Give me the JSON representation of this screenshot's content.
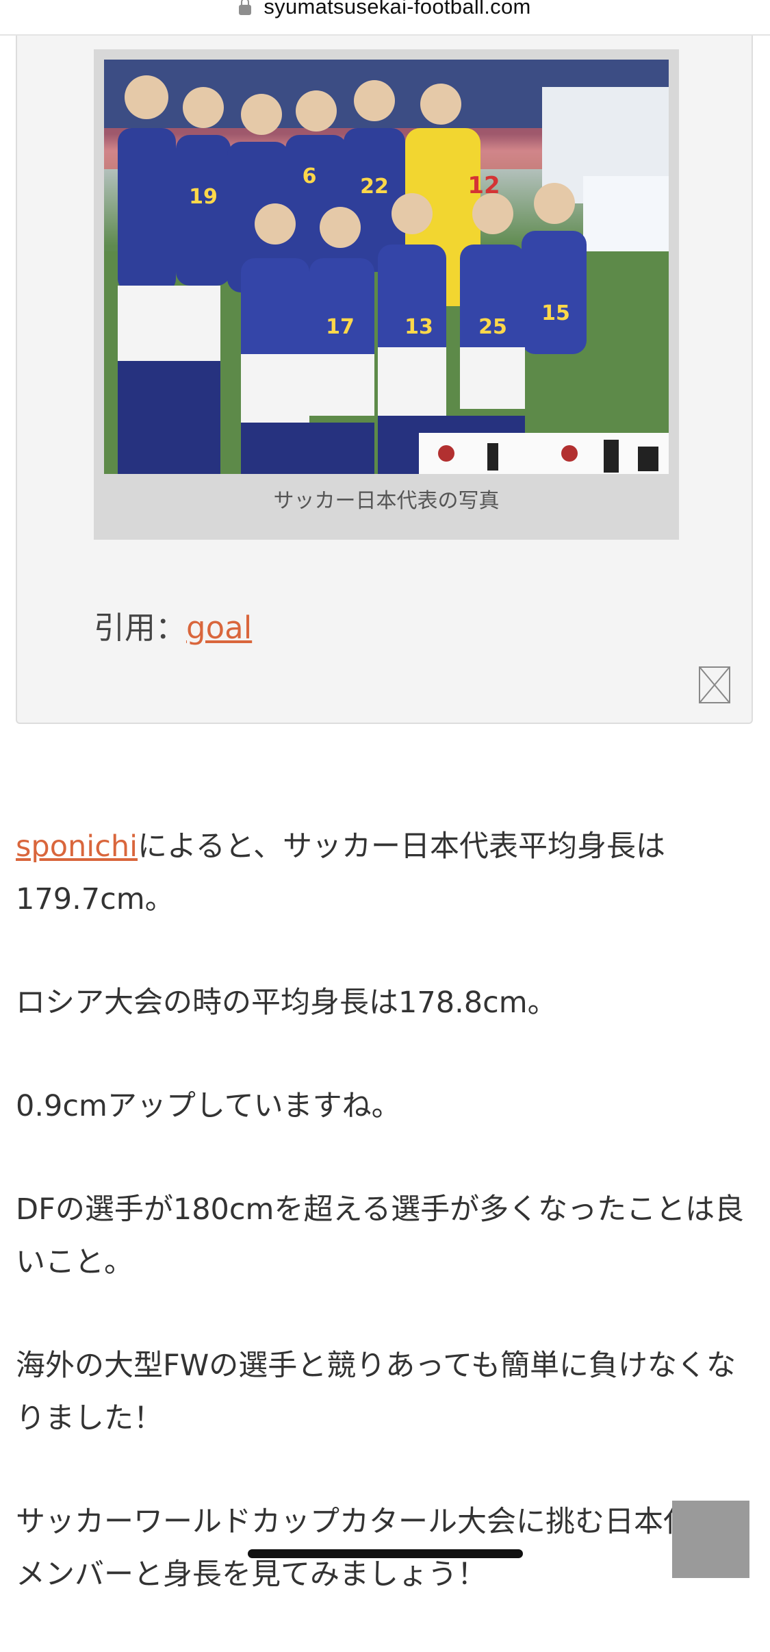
{
  "browser": {
    "url": "syumatsusekai-football.com"
  },
  "quote": {
    "caption": "サッカー日本代表の写真",
    "cite_prefix": "引用：",
    "cite_link": "goal",
    "jersey_numbers": [
      "19",
      "22",
      "12",
      "6",
      "13",
      "25",
      "15",
      "17"
    ]
  },
  "article": {
    "p1_link": "sponichi",
    "p1_text": "によると、サッカー日本代表平均身長は179.7cm。",
    "p2": "ロシア大会の時の平均身長は178.8cm。",
    "p3": "0.9cmアップしていますね。",
    "p4": "DFの選手が180cmを超える選手が多くなったことは良いこと。",
    "p5": "海外の大型FWの選手と競りあっても簡単に負けなくなりました！",
    "p6": "サッカーワールドカップカタール大会に挑む日本代表のメンバーと身長を見てみましょう！"
  },
  "colors": {
    "link": "#d9663c",
    "jersey_blue": "#2f3f9a",
    "gk_yellow": "#f2d630"
  }
}
